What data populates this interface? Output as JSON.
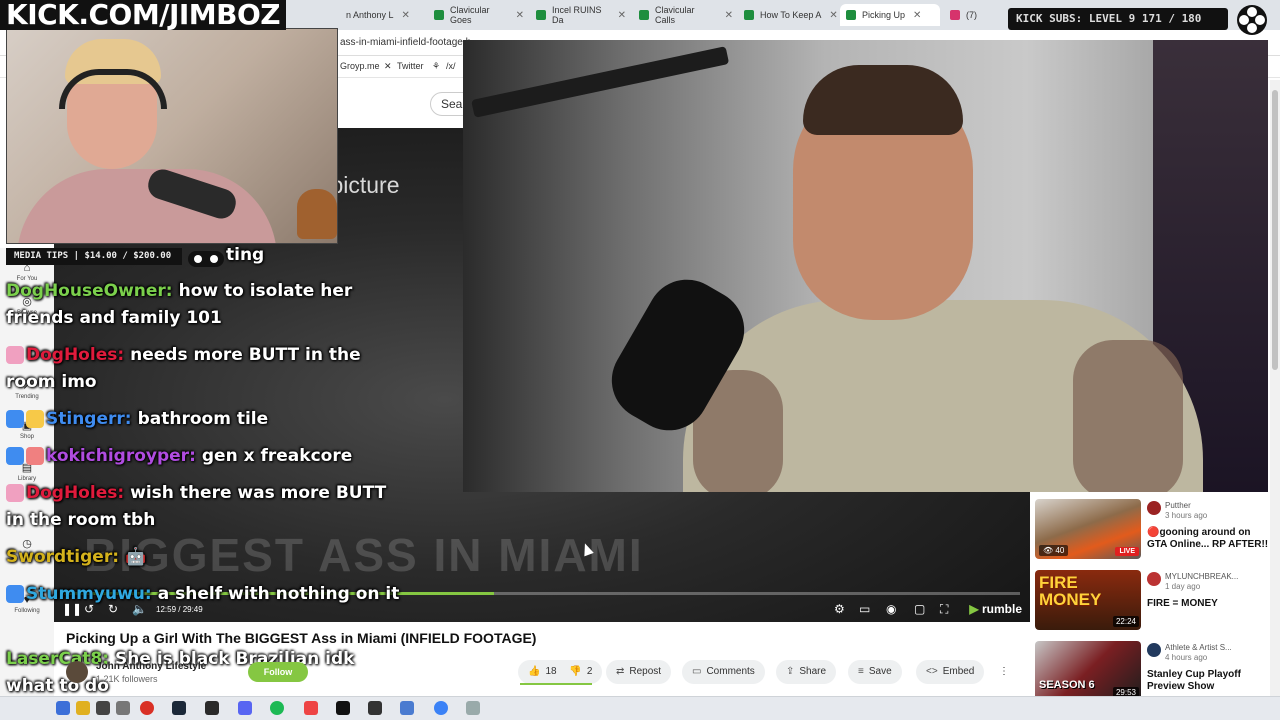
{
  "overlay": {
    "kick_banner": "KICK.COM/JIMBOZ",
    "subs_badge": "KICK SUBS: LEVEL 9 171 / 180",
    "media_tips": "MEDIA TIPS | $14.00 / $200.00"
  },
  "browser": {
    "tabs": [
      {
        "label": "n Anthony L"
      },
      {
        "label": "Clavicular Goes"
      },
      {
        "label": "Incel RUINS Da"
      },
      {
        "label": "Clavicular Calls"
      },
      {
        "label": "How To Keep A"
      },
      {
        "label": "Picking Up"
      },
      {
        "label": "(7)"
      }
    ],
    "url": "ass-in-miami-infield-footage.h",
    "bookmarks": [
      "Groyp.me",
      "Twitter",
      "/x/"
    ],
    "search_label": "Sear"
  },
  "left_rail": {
    "items": [
      {
        "label": "For You",
        "icon": "home-icon"
      },
      {
        "label": "Browse",
        "icon": "compass-icon"
      },
      {
        "label": "Trending",
        "icon": "trending-icon"
      },
      {
        "label": "Shop",
        "icon": "shop-icon"
      },
      {
        "label": "Library",
        "icon": "library-icon"
      },
      {
        "label": "Later",
        "icon": "clock-icon"
      },
      {
        "label": "Following",
        "icon": "following-icon"
      }
    ]
  },
  "player": {
    "pip_label": "n-picture",
    "thumb_title": "BIGGEST ASS IN MIAMI",
    "time": "12:59 / 29:49",
    "progress": 0.45,
    "brand": "rumble",
    "accent": "#85c742"
  },
  "chat": {
    "messages": [
      {
        "user": "",
        "text": "ting",
        "color": "#ffffff"
      },
      {
        "user": "DogHouseOwner:",
        "text": "how to isolate her friends and family 101",
        "color": "#7bd04c"
      },
      {
        "user": "DogHoles:",
        "text": "needs more BUTT in the room imo",
        "color": "#e01b3c"
      },
      {
        "user": "Stingerr:",
        "text": "bathroom tile",
        "color": "#3f8cf0"
      },
      {
        "user": "kokichigroyper:",
        "text": "gen x freakcore",
        "color": "#b04ce0"
      },
      {
        "user": "DogHoles:",
        "text": "wish there was more BUTT in the room tbh",
        "color": "#e01b3c"
      },
      {
        "user": "Swordtiger:",
        "text": "🤖",
        "color": "#d4b21c"
      },
      {
        "user": "Stummyuwu:",
        "text": "a shelf with nothing on it",
        "color": "#2fa8e0"
      },
      {
        "user": "LaserCat8:",
        "text": "She is black Brazilian idk what to do",
        "color": "#7bd04c"
      }
    ]
  },
  "video": {
    "title": "Picking Up a Girl With The BIGGEST Ass in Miami (INFIELD FOOTAGE)",
    "channel": "John Anthony Lifestyle",
    "followers": "1.21K followers",
    "follow_label": "Follow",
    "likes": "18",
    "dislikes": "2",
    "actions": {
      "repost": "Repost",
      "comments": "Comments",
      "share": "Share",
      "save": "Save",
      "embed": "Embed"
    }
  },
  "sidebar": {
    "items": [
      {
        "channel": "Putther",
        "ago": "3 hours ago",
        "title": "🔴gooning around on GTA Online... RP AFTER!!",
        "views": "40",
        "badge": "LIVE"
      },
      {
        "channel": "MYLUNCHBREAK...",
        "ago": "1 day ago",
        "title": "FIRE = MONEY",
        "duration": "22:24",
        "thumb_text": "FIRE MONEY"
      },
      {
        "channel": "Athlete & Artist S...",
        "ago": "4 hours ago",
        "title": "Stanley Cup Playoff Preview Show",
        "duration": "29:53",
        "thumb_text": "SEASON 6"
      }
    ]
  }
}
